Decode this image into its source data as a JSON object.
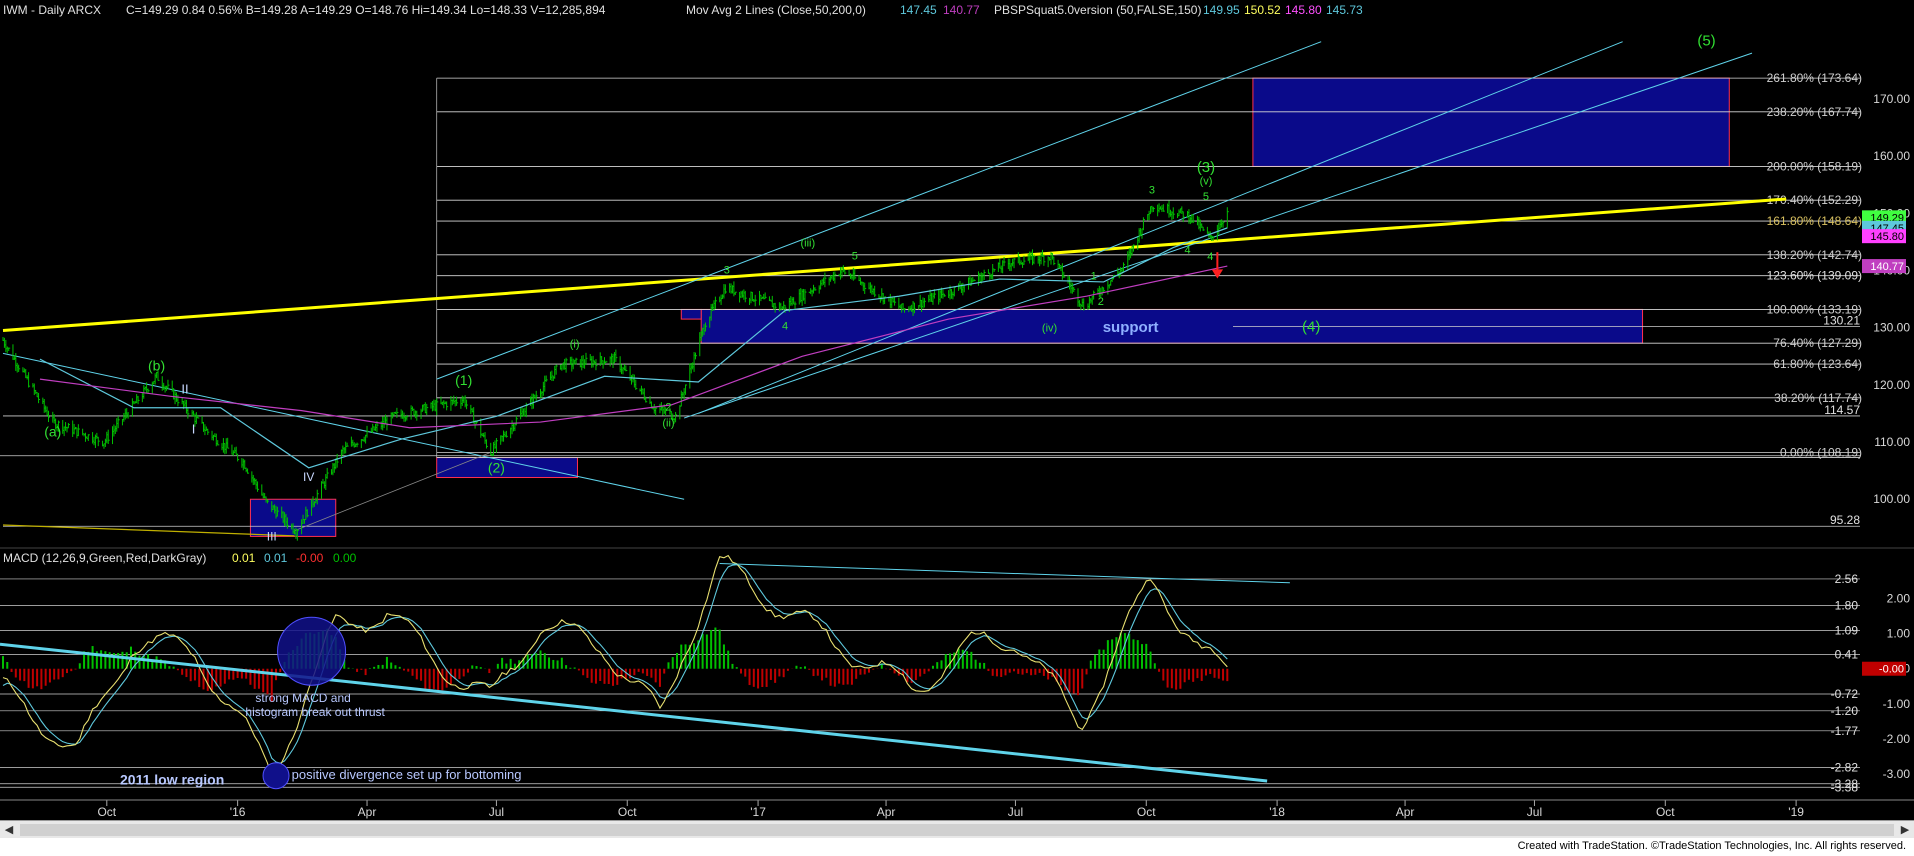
{
  "header": {
    "symbol": "IWM - Daily  ARCX",
    "quote": "C=149.29  0.84  0.56%  B=149.28  A=149.29  O=148.76  Hi=149.34  Lo=148.33  V=12,285,894",
    "mova_label": "Mov Avg 2 Lines (Close,50,200,0)",
    "mova_v1": "147.45",
    "mova_v2": "140.77",
    "squat_label": "PBSPSquat5.0version (50,FALSE,150)",
    "squat_v1": "149.95",
    "squat_v2": "150.52",
    "squat_v3": "145.80",
    "squat_v4": "145.73"
  },
  "macd_header": {
    "label": "MACD (12,26,9,Green,Red,DarkGray)",
    "v1": "0.01",
    "v2": "0.01",
    "v3": "-0.00",
    "v4": "0.00"
  },
  "colors": {
    "background": "#000000",
    "price_bars": "#00c000",
    "trendline_yellow": "#ffff00",
    "channel_cyan": "#5fd3ea",
    "ma_cyan": "#5ec8dc",
    "ma_magenta": "#c03ec0",
    "box_fill": "#0a0a8a",
    "box_border": "#ff3050",
    "fib_text": "#cfcfcf",
    "wave_green": "#32e032",
    "wave_label_white": "#c8d8ff",
    "macd_hist_pos": "#00c000",
    "macd_hist_neg": "#c00000",
    "macd_line": "#e8e070",
    "signal_line": "#5ec8dc"
  },
  "chart_data": [
    {
      "type": "line",
      "title": "IWM - Daily ARCX",
      "ylim": [
        92,
        181
      ],
      "xlim": [
        "2015-07-20",
        "2019-03-01"
      ],
      "x_ticks": [
        "Oct",
        "'16",
        "Apr",
        "Jul",
        "Oct",
        "'17",
        "Apr",
        "Jul",
        "Oct",
        "'18",
        "Apr",
        "Jul",
        "Oct",
        "'19"
      ],
      "y_ticks": [
        100,
        110,
        120,
        130,
        140,
        150,
        160,
        170
      ],
      "series": [
        {
          "x": [
            "2015-07-20",
            "2015-08-24",
            "2015-09-29",
            "2015-11-05",
            "2015-12-10",
            "2016-01-05",
            "2016-01-21",
            "2016-02-11",
            "2016-03-15",
            "2016-04-20",
            "2016-06-08",
            "2016-06-27",
            "2016-08-15",
            "2016-09-22",
            "2016-10-20",
            "2016-11-04",
            "2016-11-25",
            "2016-12-09",
            "2017-01-18",
            "2017-03-01",
            "2017-04-13",
            "2017-05-18",
            "2017-06-28",
            "2017-07-26",
            "2017-08-18",
            "2017-09-15",
            "2017-10-05",
            "2017-11-01",
            "2017-11-15",
            "2017-11-27"
          ],
          "values": [
            127.8,
            113.5,
            110.0,
            121.5,
            112.0,
            106.5,
            99.5,
            94.5,
            108.5,
            114.5,
            117.5,
            108.2,
            123.5,
            124.5,
            116.0,
            114.5,
            131.0,
            137.0,
            133.5,
            140.0,
            133.2,
            136.5,
            141.5,
            142.5,
            133.7,
            140.5,
            151.5,
            149.5,
            145.5,
            150.2
          ]
        },
        {
          "name": "Mov Avg 50",
          "x": [
            "2015-08-15",
            "2015-10-20",
            "2015-12-20",
            "2016-02-20",
            "2016-04-25",
            "2016-07-01",
            "2016-09-15",
            "2016-11-20",
            "2017-01-20",
            "2017-04-10",
            "2017-06-20",
            "2017-09-01",
            "2017-10-20",
            "2017-11-27"
          ],
          "values": [
            124.5,
            116.0,
            116.0,
            105.5,
            110.5,
            114.5,
            121.5,
            120.5,
            133.0,
            135.5,
            138.5,
            138.0,
            144.0,
            147.45
          ]
        },
        {
          "name": "Mov Avg 200",
          "x": [
            "2015-08-15",
            "2015-11-15",
            "2016-02-15",
            "2016-05-01",
            "2016-08-01",
            "2016-11-01",
            "2017-02-01",
            "2017-05-15",
            "2017-08-20",
            "2017-11-27"
          ],
          "values": [
            121.0,
            118.0,
            115.5,
            112.5,
            113.5,
            116.5,
            125.0,
            131.5,
            135.5,
            140.77
          ]
        }
      ],
      "price_labels": [
        "149.29",
        "147.45",
        "145.80",
        "140.77",
        "130.21",
        "114.57",
        "95.28"
      ],
      "fib_levels": [
        {
          "label": "261.80% (173.64)",
          "value": 173.64
        },
        {
          "label": "238.20% (167.74)",
          "value": 167.74
        },
        {
          "label": "200.00% (158.19)",
          "value": 158.19
        },
        {
          "label": "170.40% (152.29)",
          "value": 152.29
        },
        {
          "label": "161.80% (148.64)",
          "value": 148.64
        },
        {
          "label": "138.20% (142.74)",
          "value": 142.74
        },
        {
          "label": "123.60% (139.09)",
          "value": 139.09
        },
        {
          "label": "100.00% (133.19)",
          "value": 133.19
        },
        {
          "label": "76.40% (127.29)",
          "value": 127.29
        },
        {
          "label": "61.80% (123.64)",
          "value": 123.64
        },
        {
          "label": "38.20% (117.74)",
          "value": 117.74
        },
        {
          "label": "0.00% (108.19)",
          "value": 108.19
        },
        {
          "value": 107.29
        }
      ],
      "annotations": {
        "support_text": "support",
        "wave_labels": [
          "(a)",
          "(b)",
          "I",
          "II",
          "III",
          "IV",
          "(1)",
          "(2)",
          "(i)",
          "(ii)",
          "(iii)",
          "(iv)",
          "(v)",
          "(3)",
          "(4)",
          "(5)",
          "1",
          "2",
          "3",
          "4",
          "5",
          "3",
          "4",
          "5",
          "4",
          "1",
          "2",
          "3",
          "4",
          "5"
        ]
      }
    },
    {
      "type": "line",
      "title": "MACD (12,26,9,Green,Red,DarkGray)",
      "ylim": [
        -3.6,
        3.1
      ],
      "y_ticks": [
        -3.0,
        -2.0,
        -1.0,
        0.0,
        1.0,
        2.0
      ],
      "level_labels": [
        "2.56",
        "1.80",
        "1.09",
        "0.41",
        "-0.72",
        "-1.20",
        "-1.77",
        "-2.82",
        "-3.28",
        "-3.38"
      ],
      "current_value_label": "-0.00",
      "series": [
        {
          "name": "MACD",
          "x": [
            "2015-07-20",
            "2015-09-10",
            "2015-10-20",
            "2015-12-01",
            "2016-01-01",
            "2016-01-25",
            "2016-03-10",
            "2016-04-15",
            "2016-05-20",
            "2016-06-27",
            "2016-08-01",
            "2016-09-15",
            "2016-10-25",
            "2016-11-10",
            "2016-12-05",
            "2017-01-15",
            "2017-03-01",
            "2017-04-20",
            "2017-06-01",
            "2017-07-01",
            "2017-08-15",
            "2017-10-05",
            "2017-11-10",
            "2017-11-27"
          ],
          "values": [
            -0.6,
            -2.4,
            0.8,
            0.5,
            -1.4,
            -3.0,
            1.2,
            1.6,
            0.2,
            -0.9,
            1.3,
            0.6,
            -1.4,
            0.6,
            3.0,
            1.8,
            0.6,
            -0.6,
            0.7,
            0.9,
            -1.6,
            2.6,
            0.4,
            -0.1
          ]
        }
      ],
      "annotations": [
        "strong MACD  and\nhistogram break out thrust",
        "2011 low region",
        "positive divergence set up for bottoming"
      ]
    }
  ],
  "scrollbar": {
    "left_arrow": "◀",
    "right_arrow": "▶"
  },
  "footer": {
    "credit": "Created with TradeStation. ©TradeStation Technologies, Inc. All rights reserved."
  }
}
